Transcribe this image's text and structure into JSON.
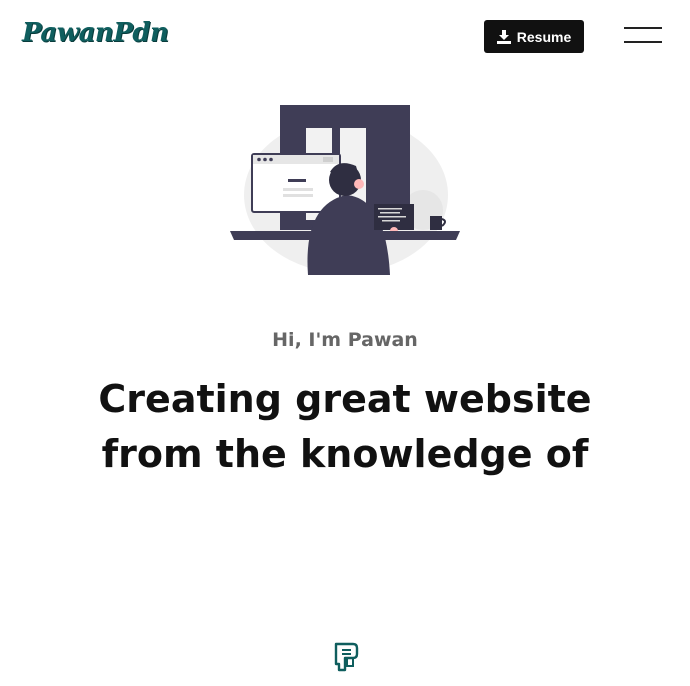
{
  "header": {
    "logo_text": "PawanPdn",
    "resume_label": "Resume",
    "resume_icon": "download-icon",
    "menu_icon": "hamburger-menu-icon"
  },
  "hero": {
    "illustration": "developer-at-desk-illustration",
    "greeting": "Hi, I'm Pawan",
    "headline_line1": "Creating great website",
    "headline_line2": "from the knowledge of"
  },
  "footer": {
    "icon": "scroll-brand-icon"
  },
  "colors": {
    "logo": "#0f5e5e",
    "button_bg": "#111111",
    "greeting": "#666666",
    "headline": "#111111",
    "illustration_dark": "#3f3d56",
    "illustration_light": "#e6e6e6"
  }
}
